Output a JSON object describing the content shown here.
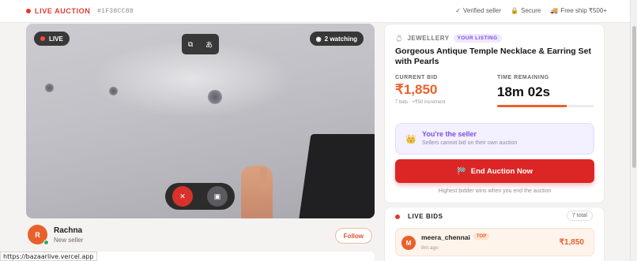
{
  "header": {
    "live_label": "LIVE AUCTION",
    "auction_id": "#1F38CC88",
    "trust": [
      {
        "icon": "check-icon",
        "glyph": "✓",
        "label": "Verified seller"
      },
      {
        "icon": "lock-icon",
        "glyph": "🔒",
        "label": "Secure"
      },
      {
        "icon": "truck-icon",
        "glyph": "🚚",
        "label": "Free ship ₹500+"
      }
    ]
  },
  "video": {
    "live_badge": "LIVE",
    "watching": "2 watching",
    "controls": {
      "flip_icon": "camera-flip-icon",
      "translate_icon": "translate-icon",
      "mic_icon": "mic-muted-icon",
      "camera_icon": "camera-icon"
    }
  },
  "seller": {
    "initial": "R",
    "name": "Rachna",
    "role": "New seller",
    "follow_label": "Follow"
  },
  "status_url": "https://bazaarlive.vercel.app",
  "listing": {
    "category": "JEWELLERY",
    "badge": "YOUR LISTING",
    "title": "Gorgeous Antique Temple Necklace & Earring Set with Pearls",
    "current_bid_label": "CURRENT BID",
    "current_bid": "₹1,850",
    "bid_meta": "7 bids · +₹50 increment",
    "time_label": "TIME REMAINING",
    "time_remaining": "18m 02s",
    "time_progress": 0.72,
    "seller_note_title": "You're the seller",
    "seller_note_sub": "Sellers cannot bid on their own auction",
    "end_button": "End Auction Now",
    "end_hint": "Highest bidder wins when you end the auction"
  },
  "live_bids": {
    "title": "LIVE BIDS",
    "total": "7 total",
    "rows": [
      {
        "initial": "M",
        "bidder": "meera_chennai",
        "badge": "TOP",
        "ago": "8m ago",
        "amount": "₹1,850"
      }
    ]
  },
  "colors": {
    "accent": "#e8612c",
    "danger": "#dc2626",
    "purple": "#7c4fe0",
    "live": "#e03a2f"
  }
}
